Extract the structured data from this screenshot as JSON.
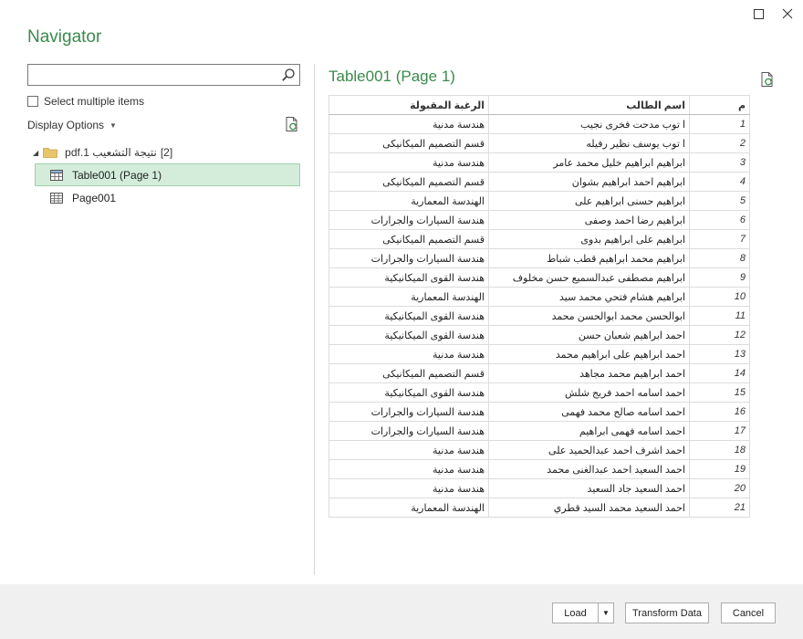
{
  "window": {
    "title": "Navigator"
  },
  "left": {
    "search": {
      "placeholder": "",
      "value": ""
    },
    "select_multiple_label": "Select multiple items",
    "display_options_label": "Display Options",
    "tree": {
      "root_label": "نتيجة التشعيب 1.pdf",
      "root_count": "[2]",
      "items": [
        {
          "label": "Table001 (Page 1)",
          "icon": "table-icon",
          "selected": true
        },
        {
          "label": "Page001",
          "icon": "page-grid-icon",
          "selected": false
        }
      ]
    }
  },
  "preview": {
    "title": "Table001 (Page 1)",
    "columns": [
      "الرغبة المقبولة",
      "اسم الطالب",
      "م"
    ],
    "rows": [
      [
        "هندسة مدنية",
        "ا توب مدحت فخرى نجيب",
        "1"
      ],
      [
        "قسم التصميم الميكانيكى",
        "ا توب يوسف نظير رفيله",
        "2"
      ],
      [
        "هندسة مدنية",
        "ابراهيم ابراهيم خليل محمد عامر",
        "3"
      ],
      [
        "قسم التصميم الميكانيكى",
        "ابراهيم احمد ابراهيم بشوان",
        "4"
      ],
      [
        "الهندسة المعمارية",
        "ابراهيم حسنى ابراهيم على",
        "5"
      ],
      [
        "هندسة السيارات والجرارات",
        "ابراهيم رضا احمد وصفى",
        "6"
      ],
      [
        "قسم التصميم الميكانيكى",
        "ابراهيم على ابراهيم بدوى",
        "7"
      ],
      [
        "هندسة السيارات والجرارات",
        "ابراهيم محمد ابراهيم قطب شباط",
        "8"
      ],
      [
        "هندسة القوى الميكانيكية",
        "ابراهيم مصطفى عبدالسميع حسن مخلوف",
        "9"
      ],
      [
        "الهندسة المعمارية",
        "ابراهيم هشام فتحي محمد سيد",
        "10"
      ],
      [
        "هندسة القوى الميكانيكية",
        "ابوالحسن محمد ابوالحسن محمد",
        "11"
      ],
      [
        "هندسة القوى الميكانيكية",
        "احمد ابراهيم شعبان حسن",
        "12"
      ],
      [
        "هندسة مدنية",
        "احمد ابراهيم على ابراهيم محمد",
        "13"
      ],
      [
        "قسم التصميم الميكانيكى",
        "احمد ابراهيم محمد مجاهد",
        "14"
      ],
      [
        "هندسة القوى الميكانيكية",
        "احمد اسامه احمد فريج شلش",
        "15"
      ],
      [
        "هندسة السيارات والجرارات",
        "احمد اسامه صالح محمد فهمى",
        "16"
      ],
      [
        "هندسة السيارات والجرارات",
        "احمد اسامه فهمى ابراهيم",
        "17"
      ],
      [
        "هندسة مدنية",
        "احمد اشرف احمد عبدالحميد على",
        "18"
      ],
      [
        "هندسة مدنية",
        "احمد السعيد احمد عبدالغنى محمد",
        "19"
      ],
      [
        "هندسة مدنية",
        "احمد السعيد جاد السعيد",
        "20"
      ],
      [
        "الهندسة المعمارية",
        "احمد السعيد محمد السيد قطري",
        "21"
      ]
    ]
  },
  "footer": {
    "load_label": "Load",
    "transform_label": "Transform Data",
    "cancel_label": "Cancel"
  },
  "colors": {
    "accent": "#3b8a4c",
    "selection_bg": "#d4eddb",
    "footer_bg": "#f0f0f0"
  },
  "icons": {
    "maximize": "maximize-icon",
    "close": "close-icon",
    "search": "search-icon",
    "refresh": "refresh-icon",
    "folder": "folder-icon",
    "expand": "chevron-down-icon"
  }
}
